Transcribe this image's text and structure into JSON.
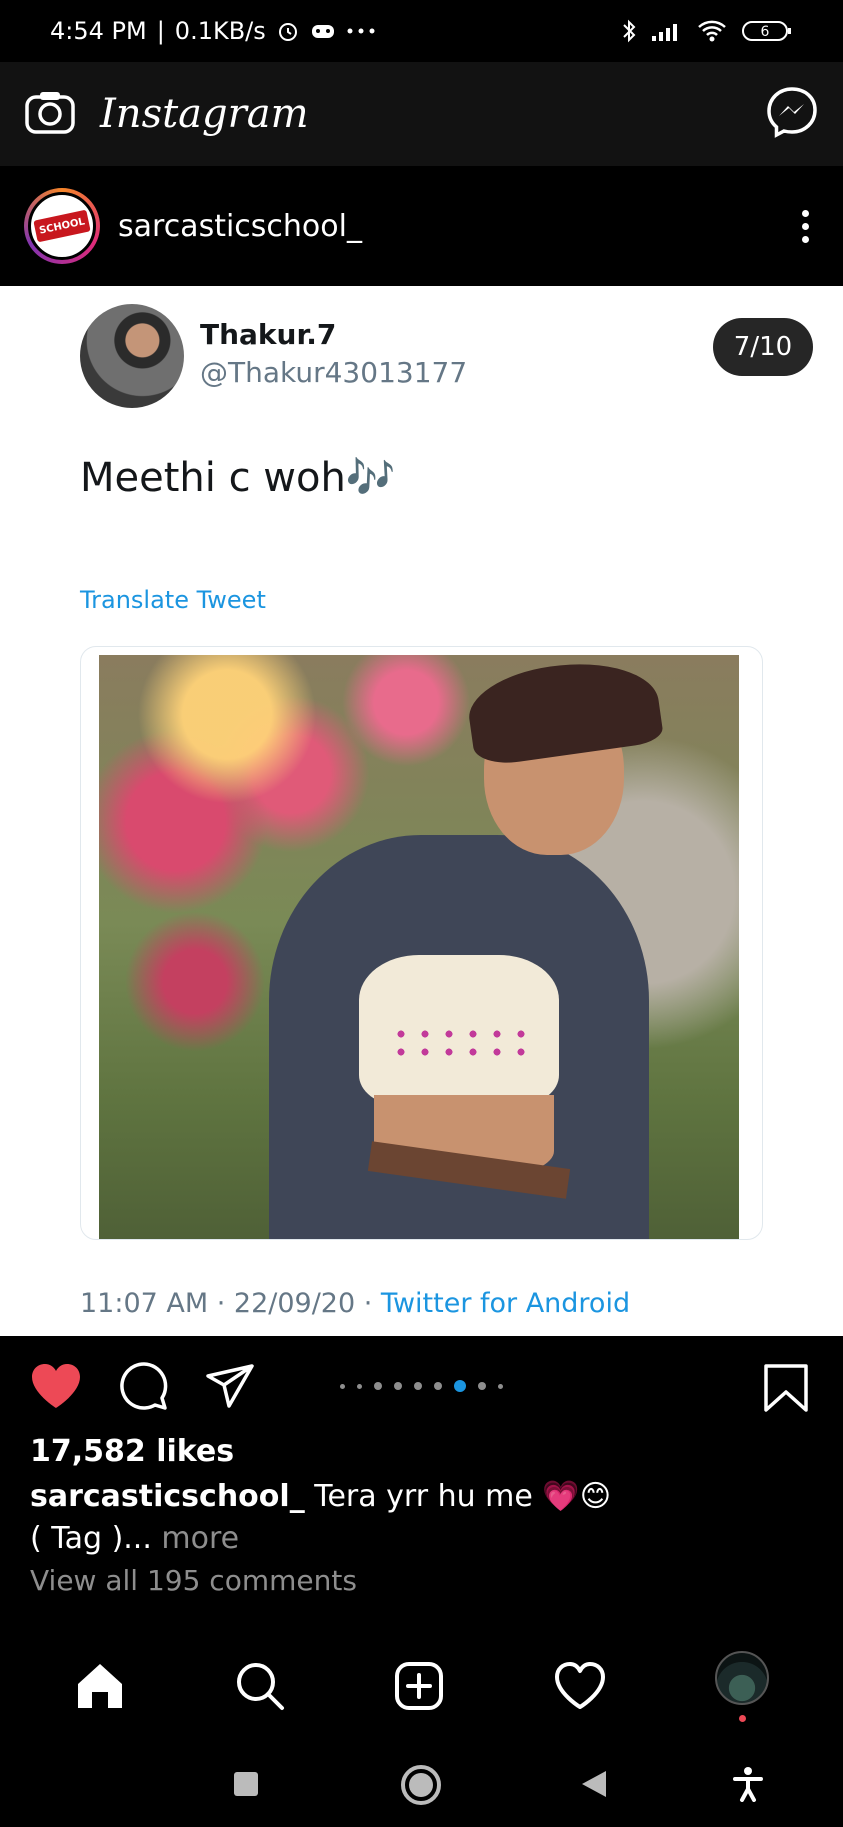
{
  "status_bar": {
    "time": "4:54 PM",
    "network_speed": "0.1KB/s",
    "battery_level": "6",
    "icons": [
      "alarm-icon",
      "gamepad-icon",
      "more-dots-icon",
      "bluetooth-icon",
      "signal-icon",
      "wifi-icon",
      "battery-icon"
    ]
  },
  "app_header": {
    "title": "Instagram",
    "left_icon": "camera-icon",
    "right_icon": "messenger-icon"
  },
  "post": {
    "username": "sarcasticschool_",
    "avatar_badge_text": "SCHOOL",
    "counter": "7/10",
    "tweet": {
      "display_name": "Thakur.7",
      "handle": "@Thakur43013177",
      "text": "Meethi c woh🎶",
      "translate_label": "Translate Tweet",
      "timestamp": "11:07 AM · 22/09/20 · ",
      "source": "Twitter for Android"
    },
    "likes": "17,582 likes",
    "caption_user": "sarcasticschool_",
    "caption_text": " Tera yrr hu me 💗😊",
    "caption_line2": "( Tag )...",
    "caption_more": " more",
    "view_comments": "View all 195 comments",
    "carousel": {
      "total": 10,
      "active_index": 6
    },
    "actions": [
      "heart-icon",
      "comment-icon",
      "share-icon",
      "bookmark-icon"
    ]
  },
  "bottom_nav": {
    "items": [
      "home-icon",
      "search-icon",
      "new-post-icon",
      "activity-icon",
      "profile-avatar"
    ]
  },
  "system_nav": {
    "items": [
      "recents-button",
      "home-button",
      "back-button",
      "accessibility-button"
    ]
  },
  "colors": {
    "like_red": "#ed4956",
    "twitter_blue": "#1b95e0",
    "header_bg": "#121212"
  }
}
